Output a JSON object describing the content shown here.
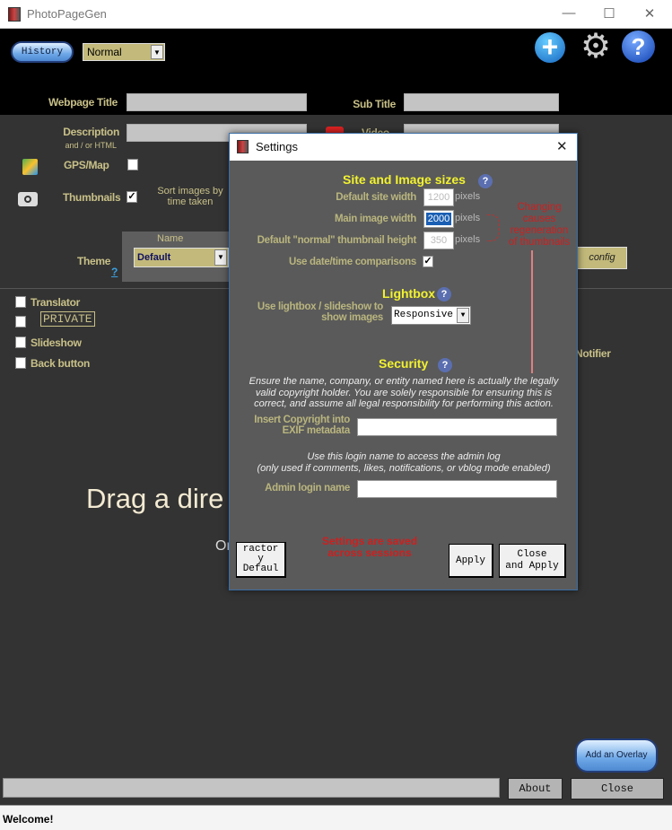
{
  "window": {
    "title": "PhotoPageGen",
    "minimize": "—",
    "maximize": "☐",
    "close": "✕"
  },
  "toolbar": {
    "history_label": "History",
    "mode_value": "Normal",
    "icons": [
      "plus-icon",
      "gear-icon",
      "help-icon"
    ]
  },
  "form": {
    "webpage_title_label": "Webpage Title",
    "webpage_title_value": "",
    "sub_title_label": "Sub Title",
    "sub_title_value": "",
    "description_label": "Description",
    "description_sub": "and / or HTML",
    "video_label": "Video",
    "gps_label": "GPS/Map",
    "gps_checked": false,
    "thumbnails_label": "Thumbnails",
    "thumbnails_checked": true,
    "sort_label_1": "Sort images by",
    "sort_label_2": "time taken",
    "theme_label": "Theme",
    "theme_help": "?",
    "theme_name_header": "Name",
    "theme_value": "Default",
    "config_label": "config"
  },
  "options": [
    {
      "label": "Translator",
      "checked": false
    },
    {
      "label": "PRIVATE",
      "checked": false
    },
    {
      "label": "Slideshow",
      "checked": false
    },
    {
      "label": "Back button",
      "checked": false
    }
  ],
  "notifier_label": "Notifier",
  "drop_text": "Drag a dire",
  "drop_sub": "Or",
  "overlay_button": "Add an Overlay",
  "about_button": "About",
  "close_button": "Close",
  "status": "Welcome!",
  "settings": {
    "title": "Settings",
    "close": "✕",
    "site_heading": "Site and Image sizes",
    "default_site_width_label": "Default site width",
    "default_site_width": "1200",
    "main_image_width_label": "Main image width",
    "main_image_width": "2000",
    "thumb_height_label": "Default \"normal\" thumbnail height",
    "thumb_height": "350",
    "pixels": "pixels",
    "regen_note": [
      "Changing",
      "causes",
      "regeneration",
      "of thumbnails"
    ],
    "date_compare_label": "Use date/time comparisons",
    "date_compare_checked": true,
    "lightbox_heading": "Lightbox",
    "lightbox_label_1": "Use lightbox / slideshow to",
    "lightbox_label_2": "show images",
    "lightbox_value": "Responsive",
    "security_heading": "Security",
    "security_note": "Ensure the name, company, or entity named here is actually the legally valid copyright holder.  You are solely responsible for ensuring this is correct, and assume all legal responsibility for performing this action.",
    "copyright_label_1": "Insert Copyright into",
    "copyright_label_2": "EXIF metadata",
    "copyright_value": "",
    "login_note_1": "Use this login name to access the admin log",
    "login_note_2": "(only used if comments, likes, notifications, or vblog mode enabled)",
    "admin_label": "Admin login name",
    "admin_value": "",
    "factory_button": "ractor y Defaul",
    "saved_note_1": "Settings are saved",
    "saved_note_2": "across sessions",
    "apply_button": "Apply",
    "close_apply_button_1": "Close",
    "close_apply_button_2": "and Apply",
    "help": "?"
  },
  "colors": {
    "accent_yellow": "#f2f230",
    "label_olive": "#c8c088",
    "warning_red": "#cc2020",
    "dialog_bg": "#5a5a5a"
  }
}
